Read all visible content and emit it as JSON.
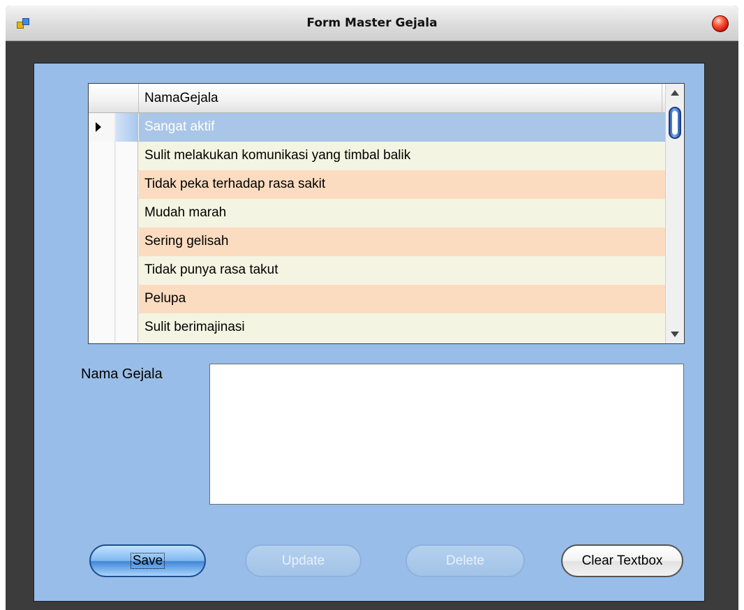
{
  "window": {
    "title": "Form Master Gejala",
    "icon": "app-form-icon",
    "close_icon": "close-icon"
  },
  "grid": {
    "column_header": "NamaGejala",
    "selected_row_index": 0,
    "rows": [
      "Sangat aktif",
      "Sulit melakukan komunikasi yang timbal balik",
      "Tidak peka terhadap rasa sakit",
      "Mudah marah",
      "Sering gelisah",
      "Tidak punya rasa takut",
      "Pelupa",
      "Sulit berimajinasi"
    ],
    "scroll_position": 0.05
  },
  "form": {
    "nama_gejala_label": "Nama Gejala",
    "nama_gejala_value": ""
  },
  "buttons": {
    "save": "Save",
    "update": "Update",
    "delete": "Delete",
    "clear": "Clear Textbox"
  },
  "colors": {
    "client_background": "#98bde8",
    "row_even": "#f4f4e2",
    "row_odd": "#fbdcc0",
    "row_selected": "#a9c6e8"
  }
}
